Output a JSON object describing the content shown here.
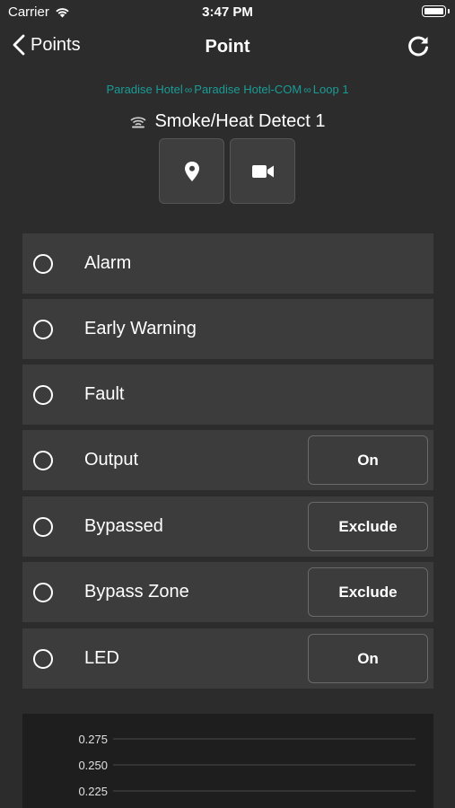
{
  "status": {
    "carrier": "Carrier",
    "time": "3:47 PM"
  },
  "nav": {
    "back_label": "Points",
    "title": "Point"
  },
  "breadcrumb": {
    "site": "Paradise Hotel",
    "panel": "Paradise Hotel-COM",
    "loop": "Loop 1"
  },
  "device": {
    "name": "Smoke/Heat Detect 1",
    "icon": "smoke-detector-icon"
  },
  "actions": [
    {
      "icon": "location-pin-icon"
    },
    {
      "icon": "video-camera-icon"
    }
  ],
  "rows": [
    {
      "label": "Alarm",
      "button": null
    },
    {
      "label": "Early Warning",
      "button": null
    },
    {
      "label": "Fault",
      "button": null
    },
    {
      "label": "Output",
      "button": "On"
    },
    {
      "label": "Bypassed",
      "button": "Exclude"
    },
    {
      "label": "Bypass Zone",
      "button": "Exclude"
    },
    {
      "label": "LED",
      "button": "On"
    }
  ],
  "chart_data": {
    "type": "line",
    "yticks": [
      "0.275",
      "0.250",
      "0.225"
    ],
    "ylim_visible": [
      0.225,
      0.275
    ],
    "grid": true,
    "series": []
  },
  "colors": {
    "background": "#2c2c2c",
    "row": "#3c3c3c",
    "breadcrumb": "#1a9c96",
    "chart_bg": "#1e1e1e"
  }
}
